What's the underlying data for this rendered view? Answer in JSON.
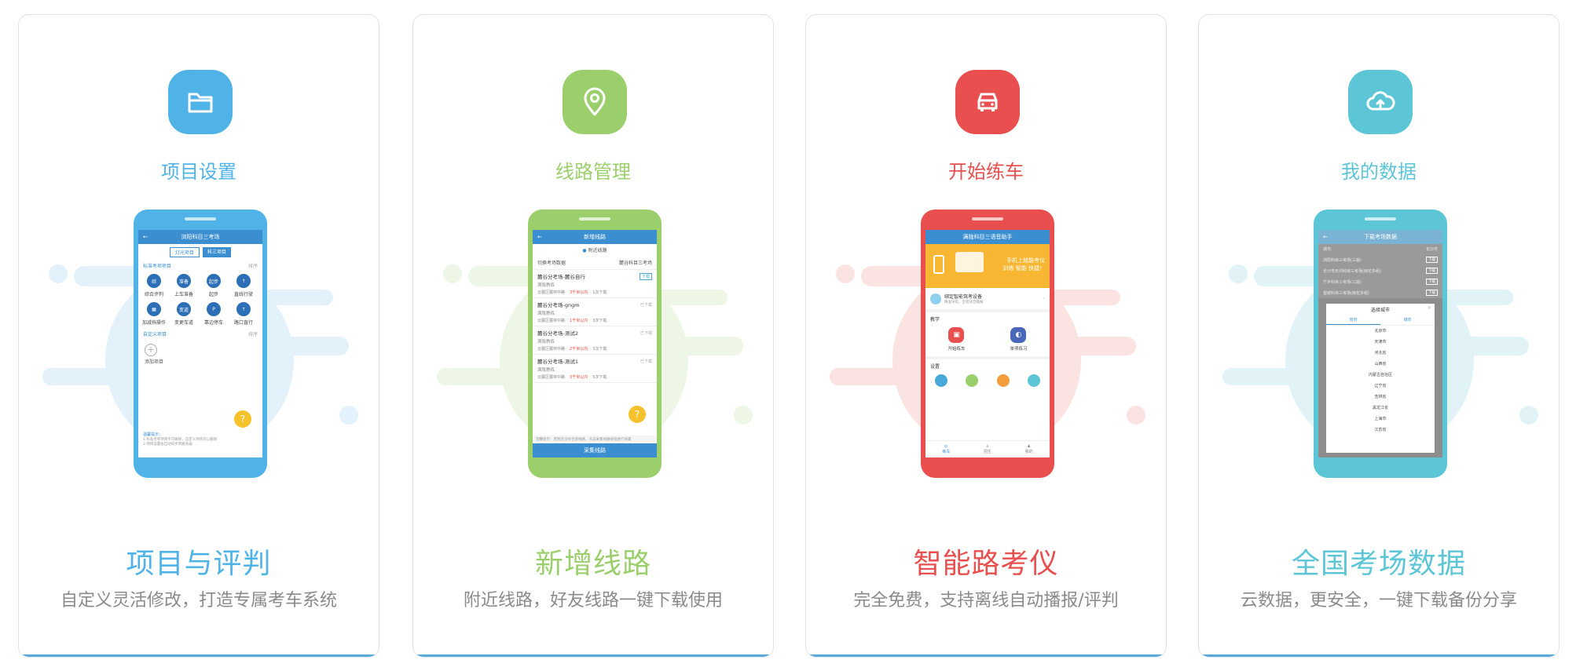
{
  "cards": [
    {
      "color": "#4fb3e8",
      "icon": "folder-icon",
      "top_title": "项目设置",
      "title": "项目与评判",
      "subtitle": "自定义灵活修改，打造专属考车系统",
      "screen": {
        "header": "浏阳科目三考场",
        "tabs": [
          "灯光项目",
          "科三项目"
        ],
        "section1": "标准考项项目",
        "sort1": "排序",
        "items": [
          "综合评判",
          "上车准备",
          "起步",
          "直线行驶",
          "加减挡操作",
          "变更车道",
          "靠边停车",
          "路口直行"
        ],
        "item_glyphs": [
          "综",
          "准备",
          "起步",
          "↑",
          "▦",
          "变道",
          "P",
          "↑"
        ],
        "section2": "自定义项目",
        "sort2": "排序",
        "add": "添加项目",
        "note_title": "温馨提示：",
        "note1": "1.标准考项项目不可删除，自定义项目可以删除",
        "note2": "2.项目设置会自动同步到服务器"
      }
    },
    {
      "color": "#9bcf6b",
      "icon": "location-pin-icon",
      "top_title": "线路管理",
      "title": "新增线路",
      "subtitle": "附近线路，好友线路一键下载使用",
      "screen": {
        "header": "新增线路",
        "nearby": "附近线路",
        "switch_label": "切换考场数据",
        "switch_value": "麓谷科目三考场",
        "routes": [
          {
            "name": "麓谷分考场-麓谷自行",
            "coach": "满陇教练",
            "dist": "云麓区麓林中路",
            "flag": "3千米以内",
            "dl": "1次下载",
            "btn": "下载"
          },
          {
            "name": "麓谷分考场-gngm",
            "coach": "满陇教练",
            "dist": "云麓区麓林中路",
            "flag": "1千米以内",
            "dl": "3次下载",
            "btn": "已下载"
          },
          {
            "name": "麓谷分考场-测试2",
            "coach": "满陇教练",
            "dist": "云麓区麓林中路",
            "flag": "2千米以内",
            "dl": "3次下载",
            "btn": "已下载"
          },
          {
            "name": "麓谷分考场-测试1",
            "coach": "满陇教练",
            "dist": "云麓区麓林中路",
            "flag": "3千米以内",
            "dl": "5次下载",
            "btn": "已下载"
          }
        ],
        "hint": "温馨提示：若附近没有合适线路，点击采集线路按钮进行采集",
        "collect": "采集线路"
      }
    },
    {
      "color": "#e94f4f",
      "icon": "car-icon",
      "top_title": "开始练车",
      "title": "智能路考仪",
      "subtitle": "完全免费，支持离线自动播报/评判",
      "screen": {
        "header": "满陇科目三语音助手",
        "banner1": "手机上就能考仪",
        "banner2": "训练 智能 快捷！",
        "device": "绑定智能驾考设备",
        "device_sub": "精准导航，全程语音播报",
        "teach": "教学",
        "start": "开始练车",
        "single": "单项练习",
        "settings": "设置",
        "tabs": [
          "练车",
          "招生",
          "我的"
        ]
      }
    },
    {
      "color": "#5cc6d6",
      "icon": "cloud-upload-icon",
      "top_title": "我的数据",
      "title": "全国考场数据",
      "subtitle": "云数据，更安全，一键下载备份分享",
      "screen": {
        "header": "下载考场数据",
        "city_label": "城市:",
        "city_value": "长沙市",
        "rows": [
          "浏阳科目三考场(三版)",
          "长沙市天鸿科目三考场(雨花多组)",
          "宁乡科目三考场(三版)",
          "望城科目三考场(雨花多组)"
        ],
        "dl": "下载",
        "dialog_title": "选择城市",
        "dialog_tabs": [
          "省份",
          "城市"
        ],
        "provinces": [
          "北京市",
          "天津市",
          "河北省",
          "山西省",
          "内蒙古自治区",
          "辽宁省",
          "吉林省",
          "黑龙江省",
          "上海市",
          "江苏省"
        ]
      }
    }
  ]
}
